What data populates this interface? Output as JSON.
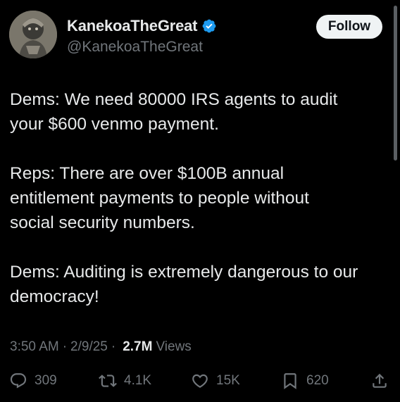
{
  "author": {
    "display_name": "KanekoaTheGreat",
    "handle": "@KanekoaTheGreat",
    "verified": true,
    "verified_color": "#1d9bf0"
  },
  "follow_button": {
    "label": "Follow"
  },
  "tweet": {
    "paragraphs": [
      "Dems: We need 80000 IRS agents to audit\nyour $600 venmo payment.",
      "Reps: There are over $100B annual\nentitlement payments to people without\nsocial security numbers.",
      "Dems: Auditing is extremely dangerous to our\ndemocracy!"
    ]
  },
  "meta": {
    "time": "3:50 AM",
    "date": "2/9/25",
    "separator": "·",
    "views_count": "2.7M",
    "views_label": "Views"
  },
  "actions": {
    "replies": "309",
    "reposts": "4.1K",
    "likes": "15K",
    "bookmarks": "620"
  },
  "icons": {
    "reply": "reply-icon",
    "repost": "repost-icon",
    "like": "heart-icon",
    "bookmark": "bookmark-icon",
    "share": "share-icon",
    "verified": "verified-badge-icon"
  }
}
